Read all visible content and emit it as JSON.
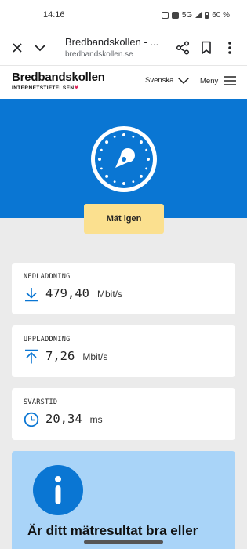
{
  "status_bar": {
    "time": "14:16",
    "network": "5G",
    "battery": "60 %"
  },
  "browser": {
    "page_title": "Bredbandskollen - ...",
    "url": "bredbandskollen.se",
    "icons": [
      "close-icon",
      "chevron-down-icon",
      "share-icon",
      "bookmark-icon",
      "more-vert-icon"
    ]
  },
  "site_header": {
    "logo_text": "Bredbandskollen",
    "logo_subtext": "INTERNETSTIFTELSEN",
    "language": "Svenska",
    "menu_label": "Meny"
  },
  "hero": {
    "background_color": "#0a76d3",
    "icon": "speedometer-icon"
  },
  "actions": {
    "measure_again": "Mät igen",
    "button_color": "#fbe08f"
  },
  "results": {
    "download": {
      "label": "NEDLADDNING",
      "value": "479,40",
      "unit": "Mbit/s",
      "icon": "download-arrow-icon"
    },
    "upload": {
      "label": "UPPLADDNING",
      "value": "7,26",
      "unit": "Mbit/s",
      "icon": "upload-arrow-icon"
    },
    "latency": {
      "label": "SVARSTID",
      "value": "20,34",
      "unit": "ms",
      "icon": "clock-icon"
    }
  },
  "info": {
    "icon": "info-icon",
    "heading": "Är ditt mätresultat bra eller",
    "background_color": "#a9d4f8"
  }
}
